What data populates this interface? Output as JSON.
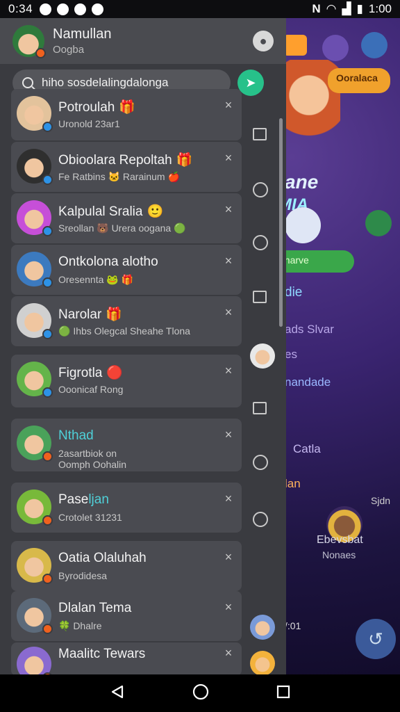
{
  "status_bar": {
    "time": "0:34",
    "right_time": "1:00",
    "network": "N"
  },
  "header": {
    "name": "Namullan",
    "subtitle": "Oogba"
  },
  "search": {
    "value": "hiho sosdelalingdalonga"
  },
  "background_app": {
    "button_label": "Ooralaca",
    "logo_line1": "ane",
    "logo_line2": "MIA",
    "green_label": "anarve",
    "text1": "die",
    "text2": "ads Slvar",
    "text3": "es",
    "text4": "nandade",
    "text5": "Catla",
    "text6": "lan",
    "text7": "Sjdn",
    "text8": "Ebevsbat",
    "text9": "Nonaes",
    "text10": "/:01"
  },
  "conversations": [
    {
      "title": "Potroulah",
      "emoji": "🎁",
      "subtitle": "Uronold 23ar1",
      "badge": "blue"
    },
    {
      "title": "Obioolara Repoltah",
      "emoji": "🎁",
      "subtitle": "Fe Ratbins 🐱 Rarainum 🍎",
      "badge": "blue"
    },
    {
      "title": "Kalpulal Sralia",
      "emoji": "🙂",
      "subtitle": "Sreollan 🐻 Urera oogana 🟢",
      "badge": "blue"
    },
    {
      "title": "Ontkolona alotho",
      "emoji": "",
      "subtitle": "Oresennta 🐸 🎁",
      "badge": "blue"
    },
    {
      "title": "Narolar",
      "emoji": "🎁",
      "subtitle": "🟢 Ihbs Olegcal Sheahe Tlona",
      "badge": "blue"
    },
    {
      "title": "Figrotla",
      "emoji": "🔴",
      "subtitle": "Ooonicaf Rong",
      "badge": "blue"
    },
    {
      "title": "Nthad",
      "emoji": "",
      "subtitle": "2asartbiok on",
      "subtitle2": "Oomph Oohalin",
      "badge": "orange",
      "teal": true
    },
    {
      "title": "Pase",
      "title_teal": "ljan",
      "emoji": "",
      "subtitle": "Crotolet 31231",
      "badge": "orange"
    },
    {
      "title": "Oatia Olaluhah",
      "emoji": "",
      "subtitle": "Byrodidesa",
      "badge": "orange"
    },
    {
      "title": "Dlalan Tema",
      "emoji": "",
      "subtitle": "🍀 Dhalre",
      "badge": "orange"
    },
    {
      "title": "Maalitc Tewars",
      "emoji": "",
      "subtitle": "",
      "badge": "orange"
    }
  ],
  "colors": {
    "panel_bg": "#3a3b40",
    "card_bg": "#4a4b51",
    "accent_green": "#27c18a",
    "teal_text": "#4fd0d8",
    "badge_blue": "#2d92e6",
    "badge_orange": "#f0611e"
  },
  "icons": {
    "profile": "person-circle-icon",
    "search": "search-icon",
    "go": "send-icon",
    "close": "close-icon",
    "image": "image-icon",
    "clock": "clock-icon"
  }
}
